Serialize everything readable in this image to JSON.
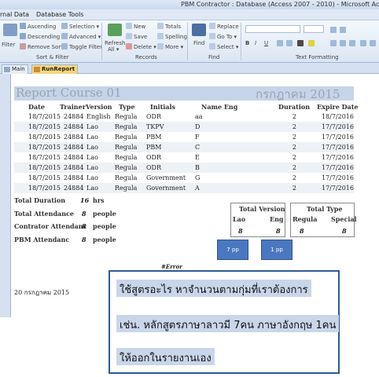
{
  "window": {
    "title": "PBM Contractor : Database (Access 2007 - 2010) -  Microsoft Access"
  },
  "menu": {
    "items": [
      "rnal Data",
      "Database Tools"
    ]
  },
  "ribbon": {
    "filter_label": "Filter",
    "ascending": "Ascending",
    "descending": "Descending",
    "remove_sort": "Remove Sort",
    "selection": "Selection",
    "advanced": "Advanced",
    "toggle_filter": "Toggle Filter",
    "sort_filter_group": "Sort & Filter",
    "refresh": "Refresh",
    "refresh_sub": "All",
    "new": "New",
    "save": "Save",
    "delete": "Delete",
    "totals": "Totals",
    "spelling": "Spelling",
    "more": "More",
    "records_group": "Records",
    "find": "Find",
    "replace": "Replace",
    "goto": "Go To",
    "select": "Select",
    "find_group": "Find",
    "text_formatting_group": "Text Formatting",
    "bold": "B",
    "italic": "I",
    "underline": "U"
  },
  "tabs": [
    {
      "label": "Main"
    },
    {
      "label": "RunReport"
    }
  ],
  "report": {
    "title": "Report Course 01",
    "month": "กรกฎาคม 2015",
    "headers": [
      "Date",
      "Trainer",
      "Version",
      "Type",
      "Initials",
      "Name Eng",
      "Duration",
      "Expire Date"
    ],
    "rows": [
      [
        "18/7/2015",
        "24884",
        "English",
        "Regula",
        "ODR",
        "aa",
        "2",
        "18/7/2016"
      ],
      [
        "18/7/2015",
        "24884",
        "Lao",
        "Regula",
        "TKPV",
        "D",
        "2",
        "17/7/2016"
      ],
      [
        "18/7/2015",
        "24884",
        "Lao",
        "Regula",
        "PBM",
        "F",
        "2",
        "17/7/2016"
      ],
      [
        "18/7/2015",
        "24884",
        "Lao",
        "Regula",
        "PBM",
        "C",
        "2",
        "17/7/2016"
      ],
      [
        "18/7/2015",
        "24884",
        "Lao",
        "Regula",
        "ODR",
        "E",
        "2",
        "17/7/2016"
      ],
      [
        "18/7/2015",
        "24884",
        "Lao",
        "Regula",
        "ODR",
        "B",
        "2",
        "17/7/2016"
      ],
      [
        "18/7/2015",
        "24884",
        "Lao",
        "Regula",
        "Government",
        "G",
        "2",
        "17/7/2016"
      ],
      [
        "18/7/2015",
        "24884",
        "Lao",
        "Regula",
        "Government",
        "A",
        "2",
        "17/7/2016"
      ]
    ],
    "summary": {
      "total_duration_label": "Total Duration",
      "total_duration_value": "16",
      "total_duration_unit": "hrs",
      "total_attendance_label": "Total Attendance",
      "total_attendance_value": "8",
      "total_attendance_unit": "people",
      "contractor_label": "Contrator Attendanc",
      "contractor_value": "8",
      "contractor_unit": "people",
      "pbm_label": "PBM Attendanc",
      "pbm_value": "8",
      "pbm_unit": "people"
    },
    "total_version": {
      "title": "Total Version",
      "col1": "Lao",
      "col2": "Eng",
      "val1": "8",
      "val2": "8"
    },
    "total_type": {
      "title": "Total Type",
      "col1": "Regula",
      "col2": "Special",
      "val1": "8",
      "val2": "8"
    },
    "pp_left": "7 pp",
    "pp_right": "1 pp",
    "error_text": "#Error",
    "footer_date": "20 กรกฎาคม 2015"
  },
  "callout": {
    "line1": "ใช้สูตรอะไร หาจำนวนตามกุ่มที่เราต้องการ",
    "line2": "เช่น. หลักสูตรภาษาลาวมี 7คน  ภาษาอังกฤษ 1คน",
    "line3": "ให้ออกในรายงานเอง"
  },
  "colors": {
    "ribbon_bg": "#dbe6f3",
    "report_header_bg": "#c5d4e8",
    "tab_active": "#f6d77a",
    "pp_button": "#4a78c0",
    "callout_border": "#2f5a92",
    "callout_line_bg": "#c9d6ea"
  }
}
